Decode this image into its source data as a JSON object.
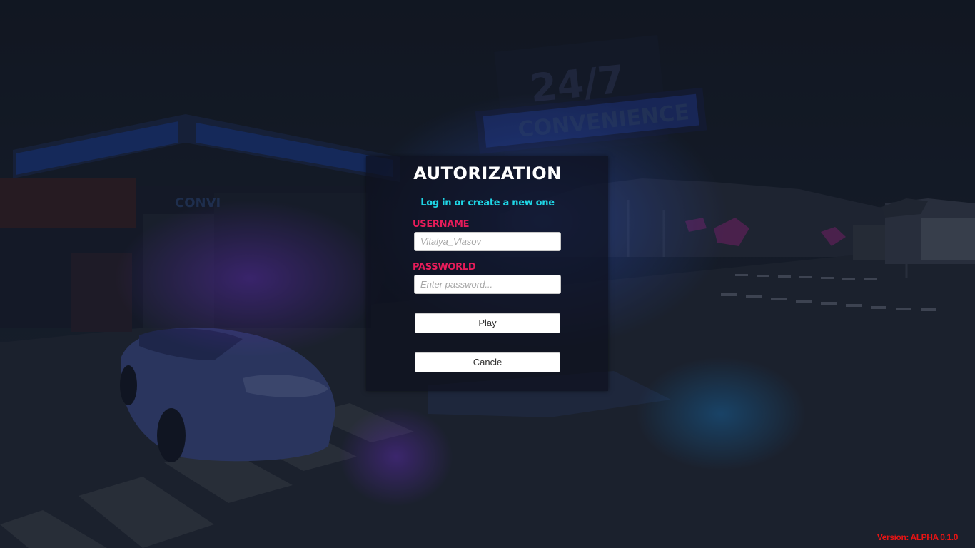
{
  "background": {
    "sign_line1": "24/7",
    "sign_line2": "CONVENIENCE",
    "station_sign": "CONVI"
  },
  "login": {
    "title": "AUTORIZATION",
    "subtitle": "Log in or create a new one",
    "username_label": "USERNAME",
    "username_placeholder": "Vitalya_Vlasov",
    "password_label": "PASSWORLD",
    "password_placeholder": "Enter password...",
    "play_label": "Play",
    "cancel_label": "Cancle"
  },
  "version_text": "Version: ALPHA 0.1.0",
  "colors": {
    "accent_cyan": "#1fd6e6",
    "accent_pink": "#e81c5a",
    "version_red": "#e81414",
    "panel_bg": "#0e101e"
  }
}
